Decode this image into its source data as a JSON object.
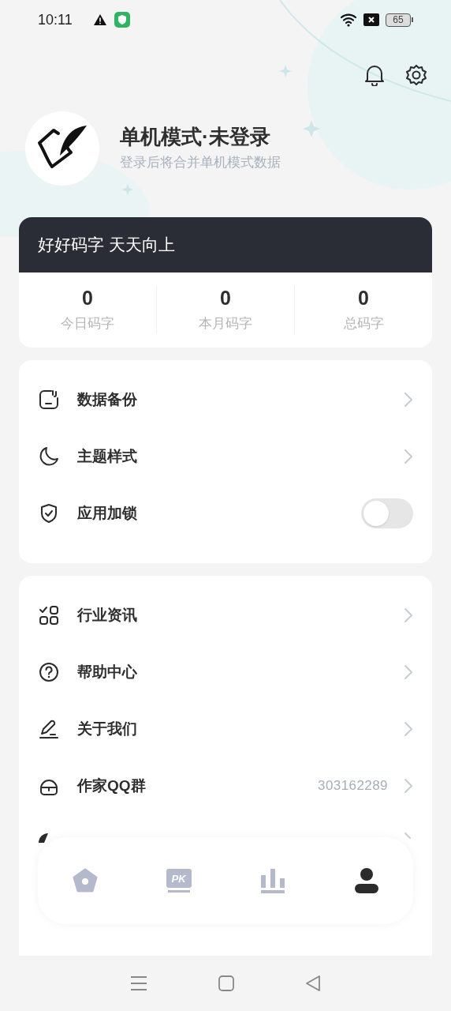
{
  "status_bar": {
    "time": "10:11",
    "battery": "65"
  },
  "profile": {
    "name": "单机模式·未登录",
    "subtitle": "登录后将合并单机模式数据"
  },
  "stats": {
    "slogan": "好好码字 天天向上",
    "items": [
      {
        "value": "0",
        "label": "今日码字"
      },
      {
        "value": "0",
        "label": "本月码字"
      },
      {
        "value": "0",
        "label": "总码字"
      }
    ]
  },
  "settings_menu": [
    {
      "kind": "link",
      "label": "数据备份"
    },
    {
      "kind": "link",
      "label": "主题样式"
    },
    {
      "kind": "toggle",
      "label": "应用加锁",
      "on": false
    }
  ],
  "info_menu": [
    {
      "kind": "link",
      "label": "行业资讯"
    },
    {
      "kind": "link",
      "label": "帮助中心"
    },
    {
      "kind": "link",
      "label": "关于我们"
    },
    {
      "kind": "link",
      "label": "作家QQ群",
      "value": "303162289"
    }
  ],
  "bottom_nav": [
    {
      "selected": false
    },
    {
      "selected": false,
      "text": "PK"
    },
    {
      "selected": false
    },
    {
      "selected": true
    }
  ]
}
